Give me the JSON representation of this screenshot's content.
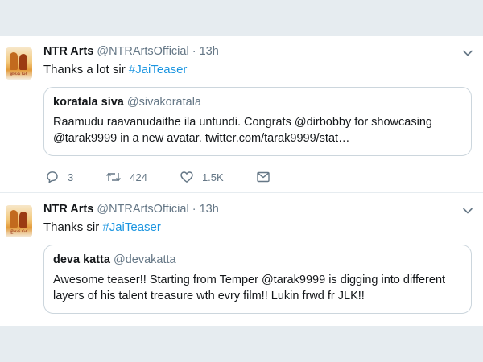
{
  "tweets": [
    {
      "author_name": "NTR Arts",
      "author_handle": "@NTRArtsOfficial",
      "separator": "·",
      "time": "13h",
      "text_prefix": "Thanks a lot sir ",
      "hashtag": "#JaiTeaser",
      "avatar_caption": "జై లవ కుశ",
      "quoted": {
        "name": "koratala siva",
        "handle": "@sivakoratala",
        "line1": "Raamudu raavanudaithe ila untundi. Congrats @dirbobby for showcasing",
        "line2": "@tarak9999 in a new avatar. twitter.com/tarak9999/stat…"
      },
      "actions": {
        "replies": "3",
        "retweets": "424",
        "likes": "1.5K"
      }
    },
    {
      "author_name": "NTR Arts",
      "author_handle": "@NTRArtsOfficial",
      "separator": "·",
      "time": "13h",
      "text_prefix": "Thanks sir ",
      "hashtag": "#JaiTeaser",
      "avatar_caption": "జై లవ కుశ",
      "quoted": {
        "name": "deva katta",
        "handle": "@devakatta",
        "line1": "Awesome teaser!! Starting from Temper @tarak9999 is digging into different",
        "line2": "layers of his talent treasure wth evry film!! Lukin frwd fr JLK!!"
      }
    }
  ],
  "icons": [
    "reply-icon",
    "retweet-icon",
    "like-icon",
    "dm-icon",
    "chevron-down-icon"
  ],
  "colors": {
    "link": "#1b95e0",
    "secondary": "#657786",
    "border": "#ccd6dd",
    "background": "#e6ecf0"
  }
}
